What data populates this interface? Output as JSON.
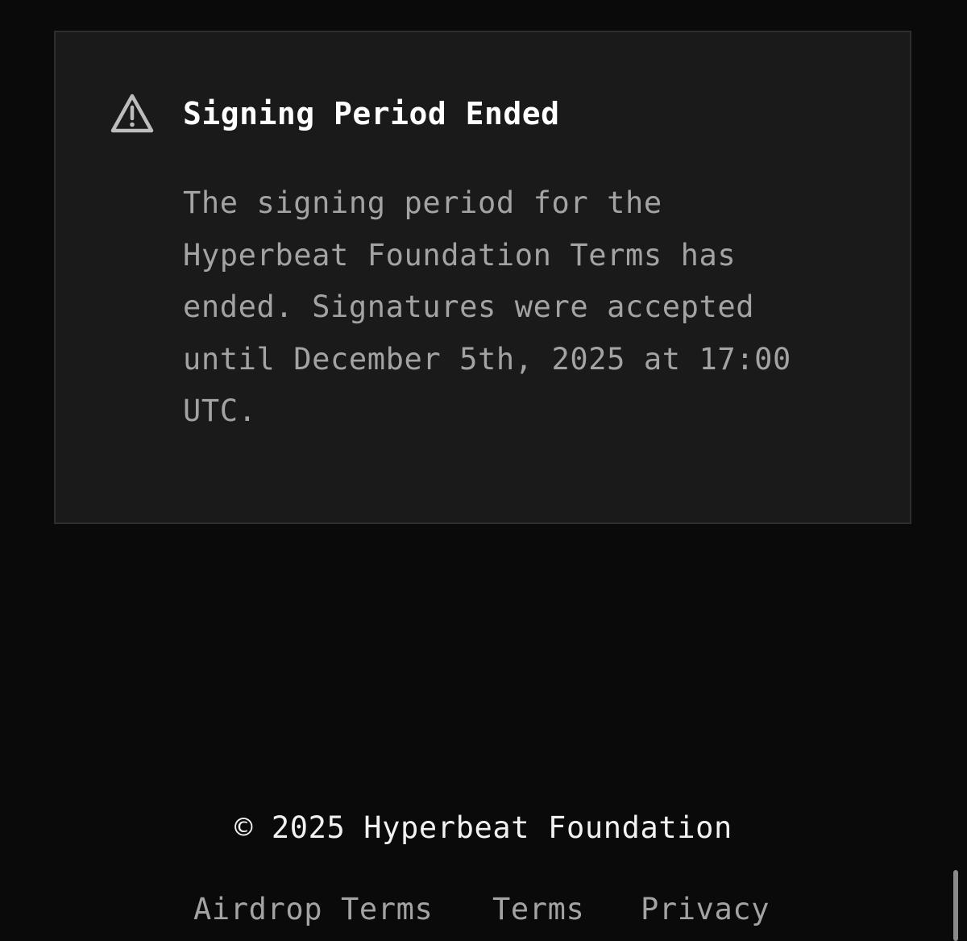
{
  "notice": {
    "icon": "warning-triangle-icon",
    "title": "Signing Period Ended",
    "body_lines": [
      "The signing period for the",
      "Hyperbeat Foundation Terms has",
      "ended. Signatures were accepted",
      "until December 5th, 2025 at 17:00",
      "UTC."
    ]
  },
  "footer": {
    "copyright": "© 2025 Hyperbeat Foundation",
    "links": [
      {
        "label": "Airdrop Terms"
      },
      {
        "label": "Terms"
      },
      {
        "label": "Privacy"
      }
    ]
  },
  "colors": {
    "page_background": "#0a0a0a",
    "card_background": "#1a1a1a",
    "card_border": "#2e2e2e",
    "title_text": "#ffffff",
    "muted_text": "#a3a3a3"
  }
}
